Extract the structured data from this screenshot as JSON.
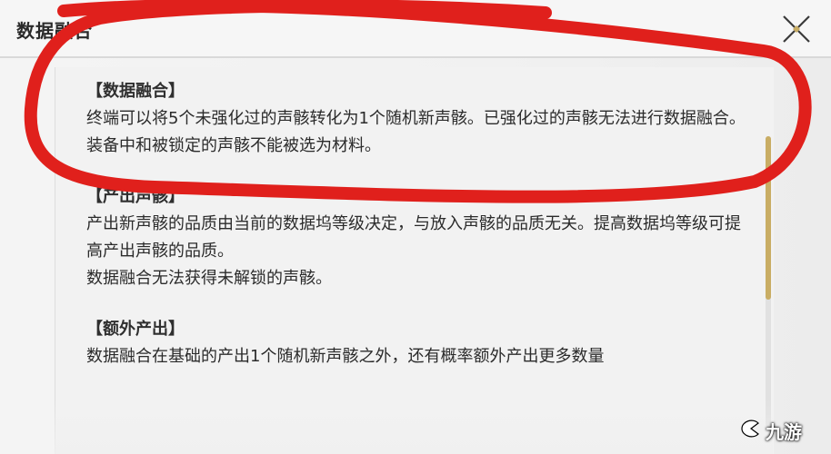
{
  "window": {
    "title": "数据融合",
    "close_icon": "close-x-icon"
  },
  "sections": [
    {
      "title": "【数据融合】",
      "lines": [
        "终端可以将5个未强化过的声骸转化为1个随机新声骸。已强化过的声骸无法进行数据融合。",
        "装备中和被锁定的声骸不能被选为材料。"
      ]
    },
    {
      "title": "【产出声骸】",
      "lines": [
        "产出新声骸的品质由当前的数据坞等级决定，与放入声骸的品质无关。提高数据坞等级可提高产出声骸的品质。",
        "数据融合无法获得未解锁的声骸。"
      ]
    },
    {
      "title": "【额外产出】",
      "lines": [
        "数据融合在基础的产出1个随机新声骸之外，还有概率额外产出更多数量"
      ]
    }
  ],
  "colors": {
    "accent_gold": "#c9ad64",
    "annotation_red": "#e0201c"
  },
  "watermark": {
    "text": "九游",
    "icon": "jiuyou-logo-icon"
  }
}
